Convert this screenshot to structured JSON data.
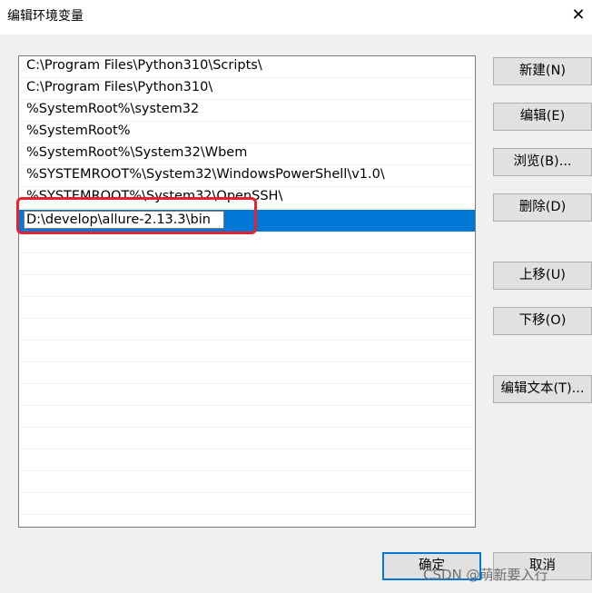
{
  "window": {
    "title": "编辑环境变量",
    "close_glyph": "✕"
  },
  "path_list": {
    "entries": [
      "C:\\Program Files\\Python310\\Scripts\\",
      "C:\\Program Files\\Python310\\",
      "%SystemRoot%\\system32",
      "%SystemRoot%",
      "%SystemRoot%\\System32\\Wbem",
      "%SYSTEMROOT%\\System32\\WindowsPowerShell\\v1.0\\",
      "%SYSTEMROOT%\\System32\\OpenSSH\\"
    ],
    "editing_value": "D:\\develop\\allure-2.13.3\\bin"
  },
  "buttons": {
    "new": "新建(N)",
    "edit": "编辑(E)",
    "browse": "浏览(B)...",
    "delete": "删除(D)",
    "move_up": "上移(U)",
    "move_down": "下移(O)",
    "edit_text": "编辑文本(T)...",
    "ok": "确定",
    "cancel": "取消"
  },
  "watermark": "CSDN @萌新要入行",
  "colors": {
    "selection": "#0078d7",
    "annotation_red": "#e8212a"
  }
}
